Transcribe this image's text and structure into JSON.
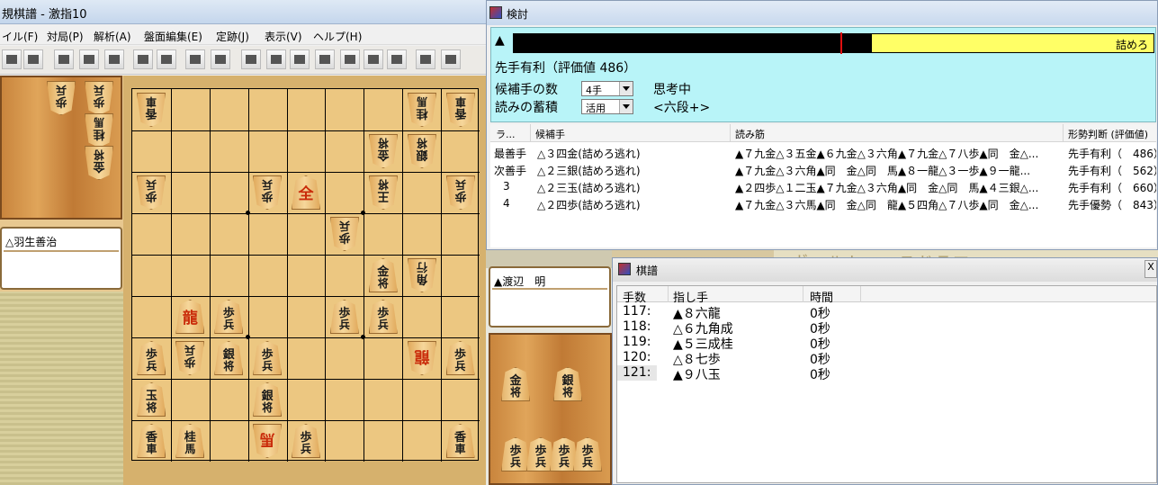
{
  "main_window": {
    "title": "規棋譜 - 激指10",
    "menu": [
      "イル(F)",
      "対局(P)",
      "解析(A)",
      "盤面編集(E)",
      "定跡(J)",
      "表示(V)",
      "ヘルプ(H)"
    ],
    "toolbar_icons": [
      "blank-icon",
      "folder-icon",
      "blank-icon",
      "blank-icon",
      "blank-icon",
      "board-icon",
      "save-icon",
      "flip-icon",
      "flip2-icon",
      "first-icon",
      "back-icon",
      "prev-icon",
      "stop-icon",
      "next-icon",
      "forward-icon",
      "last-icon",
      "monitor-icon",
      "help-icon"
    ]
  },
  "gote": {
    "name": "△羽生善治",
    "hand": [
      "歩",
      "歩",
      "桂",
      "金"
    ]
  },
  "sente": {
    "name": "▲渡辺　明",
    "hand": [
      "金",
      "銀",
      "歩",
      "歩",
      "歩",
      "歩"
    ]
  },
  "board": {
    "pieces": [
      {
        "col": 9,
        "row": 1,
        "t": [
          "香",
          "車"
        ],
        "side": "gote"
      },
      {
        "col": 2,
        "row": 1,
        "t": [
          "桂",
          "馬"
        ],
        "side": "gote"
      },
      {
        "col": 1,
        "row": 1,
        "t": [
          "香",
          "車"
        ],
        "side": "gote"
      },
      {
        "col": 3,
        "row": 2,
        "t": [
          "金",
          "将"
        ],
        "side": "gote"
      },
      {
        "col": 2,
        "row": 2,
        "t": [
          "銀",
          "将"
        ],
        "side": "gote"
      },
      {
        "col": 9,
        "row": 3,
        "t": [
          "歩",
          "兵"
        ],
        "side": "gote"
      },
      {
        "col": 6,
        "row": 3,
        "t": [
          "歩",
          "兵"
        ],
        "side": "gote"
      },
      {
        "col": 5,
        "row": 3,
        "t": [
          "全"
        ],
        "side": "sente",
        "red": true
      },
      {
        "col": 3,
        "row": 3,
        "t": [
          "王",
          "将"
        ],
        "side": "gote"
      },
      {
        "col": 1,
        "row": 3,
        "t": [
          "歩",
          "兵"
        ],
        "side": "gote"
      },
      {
        "col": 4,
        "row": 4,
        "t": [
          "歩",
          "兵"
        ],
        "side": "gote"
      },
      {
        "col": 3,
        "row": 5,
        "t": [
          "金",
          "将"
        ],
        "side": "sente"
      },
      {
        "col": 2,
        "row": 5,
        "t": [
          "角",
          "行"
        ],
        "side": "gote"
      },
      {
        "col": 8,
        "row": 6,
        "t": [
          "龍"
        ],
        "side": "sente",
        "red": true
      },
      {
        "col": 7,
        "row": 6,
        "t": [
          "歩",
          "兵"
        ],
        "side": "sente"
      },
      {
        "col": 4,
        "row": 6,
        "t": [
          "歩",
          "兵"
        ],
        "side": "sente"
      },
      {
        "col": 3,
        "row": 6,
        "t": [
          "歩",
          "兵"
        ],
        "side": "sente"
      },
      {
        "col": 9,
        "row": 7,
        "t": [
          "歩",
          "兵"
        ],
        "side": "sente"
      },
      {
        "col": 8,
        "row": 7,
        "t": [
          "歩",
          "兵"
        ],
        "side": "gote"
      },
      {
        "col": 7,
        "row": 7,
        "t": [
          "銀",
          "将"
        ],
        "side": "sente"
      },
      {
        "col": 6,
        "row": 7,
        "t": [
          "歩",
          "兵"
        ],
        "side": "sente"
      },
      {
        "col": 2,
        "row": 7,
        "t": [
          "龍"
        ],
        "side": "gote",
        "red": true
      },
      {
        "col": 1,
        "row": 7,
        "t": [
          "歩",
          "兵"
        ],
        "side": "sente"
      },
      {
        "col": 9,
        "row": 8,
        "t": [
          "玉",
          "将"
        ],
        "side": "sente"
      },
      {
        "col": 6,
        "row": 8,
        "t": [
          "銀",
          "将"
        ],
        "side": "sente"
      },
      {
        "col": 9,
        "row": 9,
        "t": [
          "香",
          "車"
        ],
        "side": "sente"
      },
      {
        "col": 8,
        "row": 9,
        "t": [
          "桂",
          "馬"
        ],
        "side": "sente"
      },
      {
        "col": 6,
        "row": 9,
        "t": [
          "馬"
        ],
        "side": "gote",
        "red": true
      },
      {
        "col": 5,
        "row": 9,
        "t": [
          "歩",
          "兵"
        ],
        "side": "sente"
      },
      {
        "col": 1,
        "row": 9,
        "t": [
          "香",
          "車"
        ],
        "side": "sente"
      }
    ]
  },
  "kentou": {
    "title": "検討",
    "eval_marker": "▲",
    "eval_label": "詰めろ",
    "eval_fill_fraction": 0.44,
    "eval_text": "先手有利（評価値 486）",
    "cand_label": "候補手の数",
    "cand_value": "4手",
    "thinking": "思考中",
    "acc_label": "読みの蓄積",
    "acc_value": "活用",
    "level": "<六段+>",
    "columns": [
      "ラ...",
      "候補手",
      "読み筋",
      "形勢判断 (評価値)"
    ],
    "rows": [
      {
        "rank": "最善手",
        "move": "△３四金(詰めろ逃れ)",
        "pv": "▲７九金△３五金▲６九金△３六角▲７九金△７八歩▲同　金△...",
        "judge": "先手有利（　486）"
      },
      {
        "rank": "次善手",
        "move": "△２三銀(詰めろ逃れ)",
        "pv": "▲７九金△３六角▲同　金△同　馬▲８一龍△３一歩▲９一龍...",
        "judge": "先手有利（　562）"
      },
      {
        "rank": "3",
        "move": "△２三玉(詰めろ逃れ)",
        "pv": "▲２四歩△１二玉▲７九金△３六角▲同　金△同　馬▲４三銀△...",
        "judge": "先手有利（　660）"
      },
      {
        "rank": "4",
        "move": "△２四歩(詰めろ逃れ)",
        "pv": "▲７九金△３六馬▲同　金△同　龍▲５四角△７八歩▲同　金△...",
        "judge": "先手優勢（　843）"
      }
    ]
  },
  "kifu": {
    "title": "棋譜",
    "close": "X",
    "columns": [
      "手数",
      "指し手",
      "時間"
    ],
    "rows": [
      {
        "n": "117:",
        "move": "▲８六龍",
        "time": "0秒"
      },
      {
        "n": "118:",
        "move": "△６九角成",
        "time": "0秒"
      },
      {
        "n": "119:",
        "move": "▲５三成桂",
        "time": "0秒"
      },
      {
        "n": "120:",
        "move": "△８七歩",
        "time": "0秒"
      },
      {
        "n": "121:",
        "move": "▲９八玉",
        "time": "0秒"
      }
    ]
  },
  "wallpaper_text": "ヴィルトゥースドラマ"
}
